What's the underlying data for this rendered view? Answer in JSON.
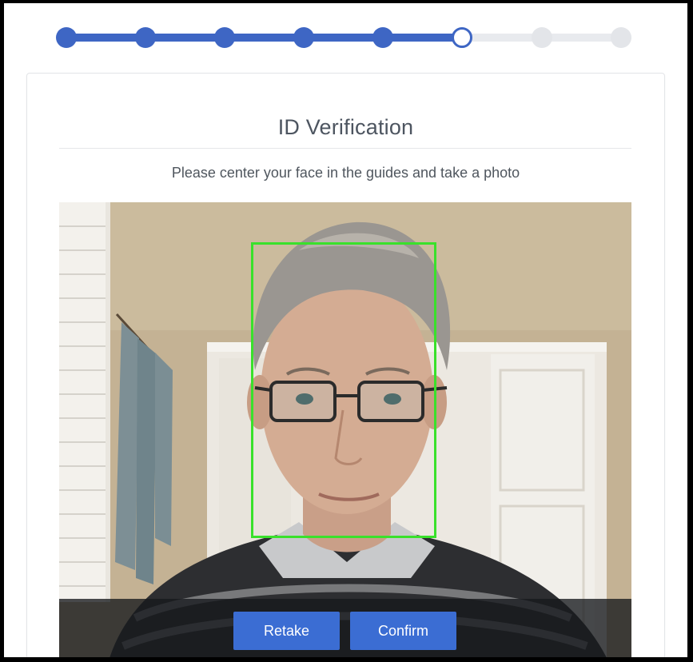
{
  "stepper": {
    "steps": [
      {
        "state": "done"
      },
      {
        "state": "done"
      },
      {
        "state": "done"
      },
      {
        "state": "done"
      },
      {
        "state": "done"
      },
      {
        "state": "current"
      },
      {
        "state": "todo"
      },
      {
        "state": "todo"
      }
    ],
    "current_step": 6,
    "total_steps": 8,
    "colors": {
      "done": "#3e66c4",
      "todo": "#e3e5e9"
    }
  },
  "card": {
    "title": "ID Verification",
    "instructions": "Please center your face in the guides and take a photo"
  },
  "camera": {
    "face_guide_color": "#39e12b",
    "retake_label": "Retake",
    "confirm_label": "Confirm",
    "button_color": "#3b6dd3"
  }
}
